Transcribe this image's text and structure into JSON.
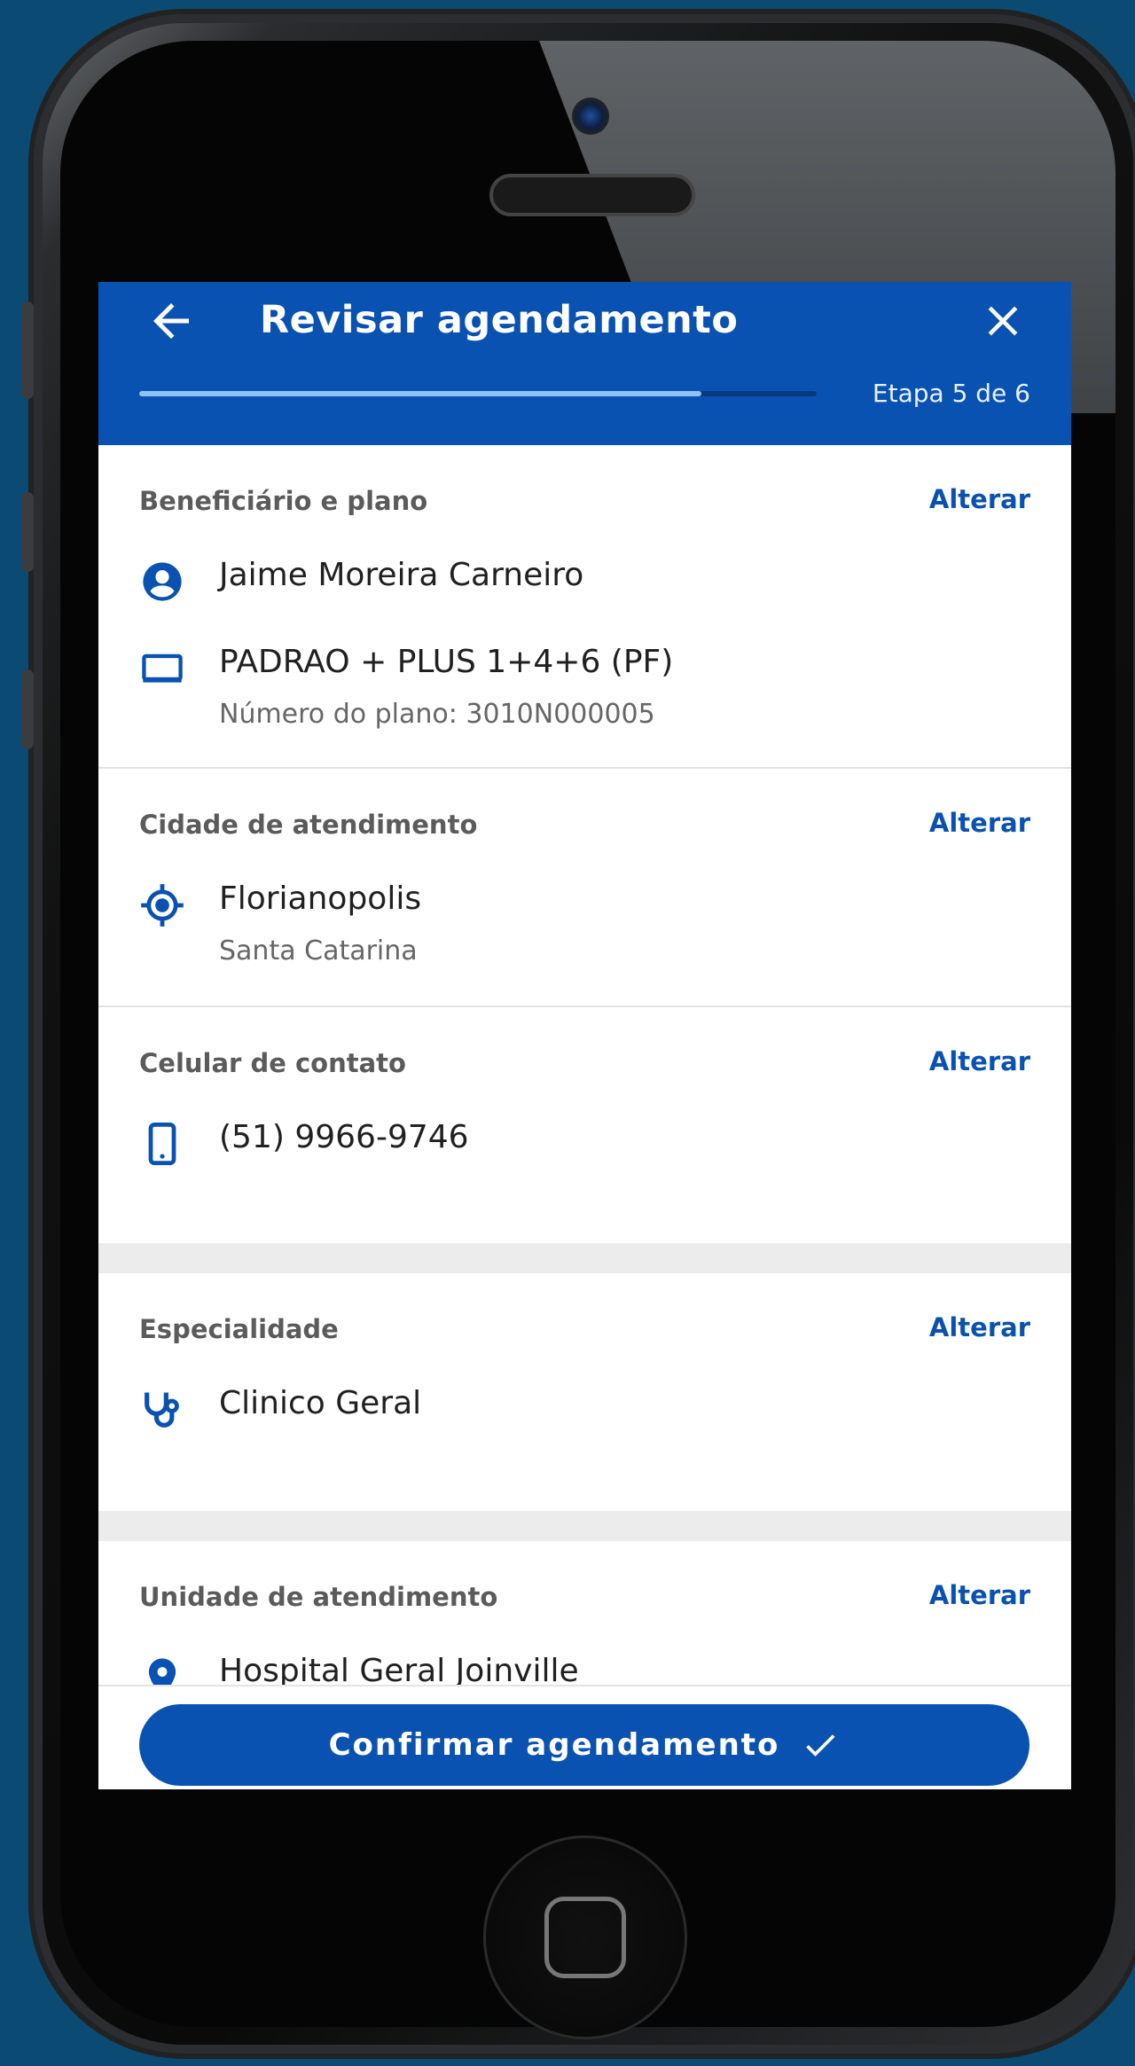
{
  "header": {
    "title": "Revisar agendamento",
    "step_text": "Etapa 5 de 6",
    "progress": 0.83
  },
  "sections": {
    "beneficiary": {
      "label": "Beneficiário e plano",
      "action": "Alterar",
      "name": "Jaime Moreira Carneiro",
      "plan": "PADRAO + PLUS 1+4+6 (PF)",
      "plan_number": "Número do plano: 3010N000005"
    },
    "city": {
      "label": "Cidade de atendimento",
      "action": "Alterar",
      "city": "Florianopolis",
      "state": "Santa Catarina"
    },
    "phone": {
      "label": "Celular de contato",
      "action": "Alterar",
      "number": "(51) 9966-9746"
    },
    "specialty": {
      "label": "Especialidade",
      "action": "Alterar",
      "value": "Clinico Geral"
    },
    "unit": {
      "label": "Unidade de atendimento",
      "action": "Alterar",
      "value": "Hospital Geral Joinville"
    }
  },
  "footer": {
    "confirm_label": "Confirmar agendamento"
  },
  "colors": {
    "brand": "#0a52b2",
    "background": "#0b4a73"
  },
  "icons": [
    "back-arrow-icon",
    "close-icon",
    "user-circle-icon",
    "card-icon",
    "location-target-icon",
    "smartphone-icon",
    "stethoscope-icon",
    "map-pin-icon",
    "check-icon"
  ]
}
